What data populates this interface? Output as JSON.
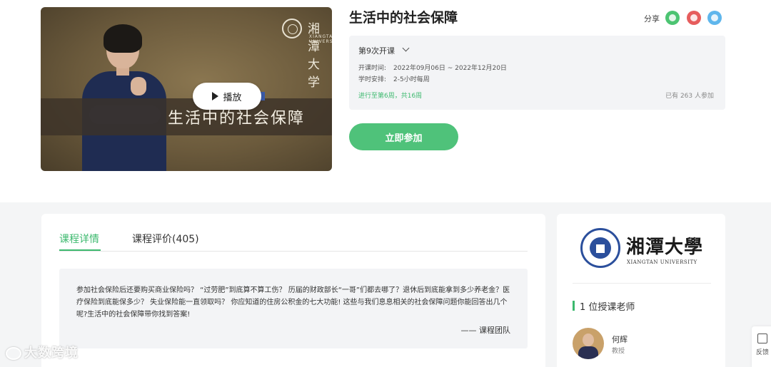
{
  "video": {
    "banner_title": "生活中的社会保障",
    "logo_name": "湘潭大学",
    "logo_sub": "XIANGTAN UNIVERSITY",
    "play_label": "播放"
  },
  "course": {
    "title": "生活中的社会保障",
    "share_label": "分享",
    "share_icons": [
      "wechat-icon",
      "weibo-icon",
      "qq-icon"
    ]
  },
  "info": {
    "session": "第9次开课",
    "time_label": "开课时间:",
    "time_value": "2022年09月06日 ~ 2022年12月20日",
    "schedule_label": "学时安排:",
    "schedule_value": "2-5小时每周",
    "progress": "进行至第6周，共16周",
    "count": "已有 263 人参加"
  },
  "join_label": "立即参加",
  "tabs": {
    "detail": "课程详情",
    "review": "课程评价(405)"
  },
  "description": {
    "text": "参加社会保险后还要购买商业保险吗？ “过劳肥”到底算不算工伤？ 历届的财政部长“一哥”们都去哪了？退休后到底能拿到多少养老金？医疗保险到底能保多少？ 失业保险能一直领取吗？ 你应知道的住房公积金的七大功能! 这些与我们息息相关的社会保障问题你能回答出几个呢?生活中的社会保障带你找到答案!",
    "signature": "—— 课程团队"
  },
  "side": {
    "uni_name": "湘潭大學",
    "uni_sub": "XIANGTAN UNIVERSITY",
    "teacher_heading": "1 位授课老师",
    "teacher_name": "何辉",
    "teacher_role": "教授"
  },
  "feedback_label": "反馈",
  "watermark": "大数跨境",
  "colors": {
    "accent": "#3cb96e",
    "button": "#4fc27a",
    "wechat": "#4cc472",
    "weibo": "#e65d5d",
    "qq": "#5fb6ec"
  }
}
